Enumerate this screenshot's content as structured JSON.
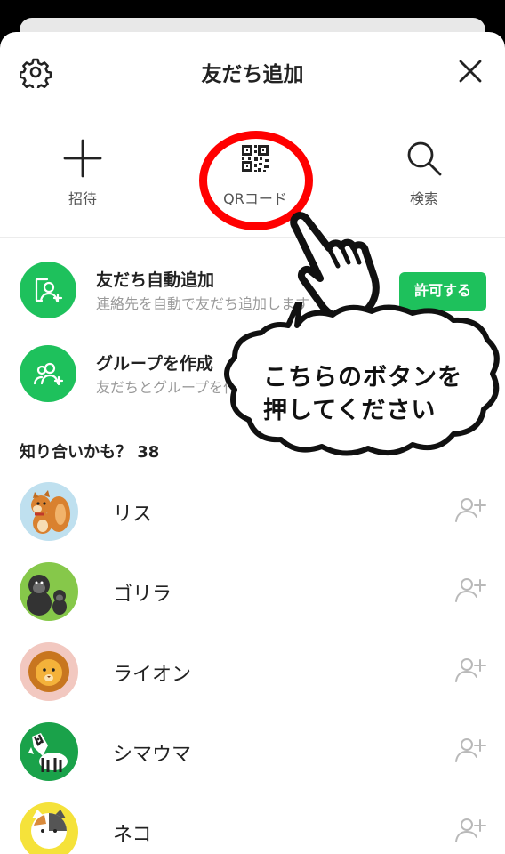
{
  "header": {
    "title": "友だち追加"
  },
  "actions": [
    {
      "label": "招待",
      "icon": "plus-icon"
    },
    {
      "label": "QRコード",
      "icon": "qr-code-icon"
    },
    {
      "label": "検索",
      "icon": "search-icon"
    }
  ],
  "features": {
    "auto_add": {
      "title": "友だち自動追加",
      "desc": "連絡先を自動で友だち追加します",
      "button": "許可する"
    },
    "group": {
      "title": "グループを作成",
      "desc": "友だちとグループを作成"
    }
  },
  "section": {
    "title": "知り合いかも？ 38"
  },
  "friends": [
    {
      "name": "リス",
      "avatar": "squirrel"
    },
    {
      "name": "ゴリラ",
      "avatar": "gorilla"
    },
    {
      "name": "ライオン",
      "avatar": "lion"
    },
    {
      "name": "シマウマ",
      "avatar": "zebra"
    },
    {
      "name": "ネコ",
      "avatar": "cat"
    }
  ],
  "annotation": {
    "line1": "こちらのボタンを",
    "line2": "押してください"
  },
  "colors": {
    "accent": "#1ec15c",
    "highlight": "#ff0000"
  }
}
